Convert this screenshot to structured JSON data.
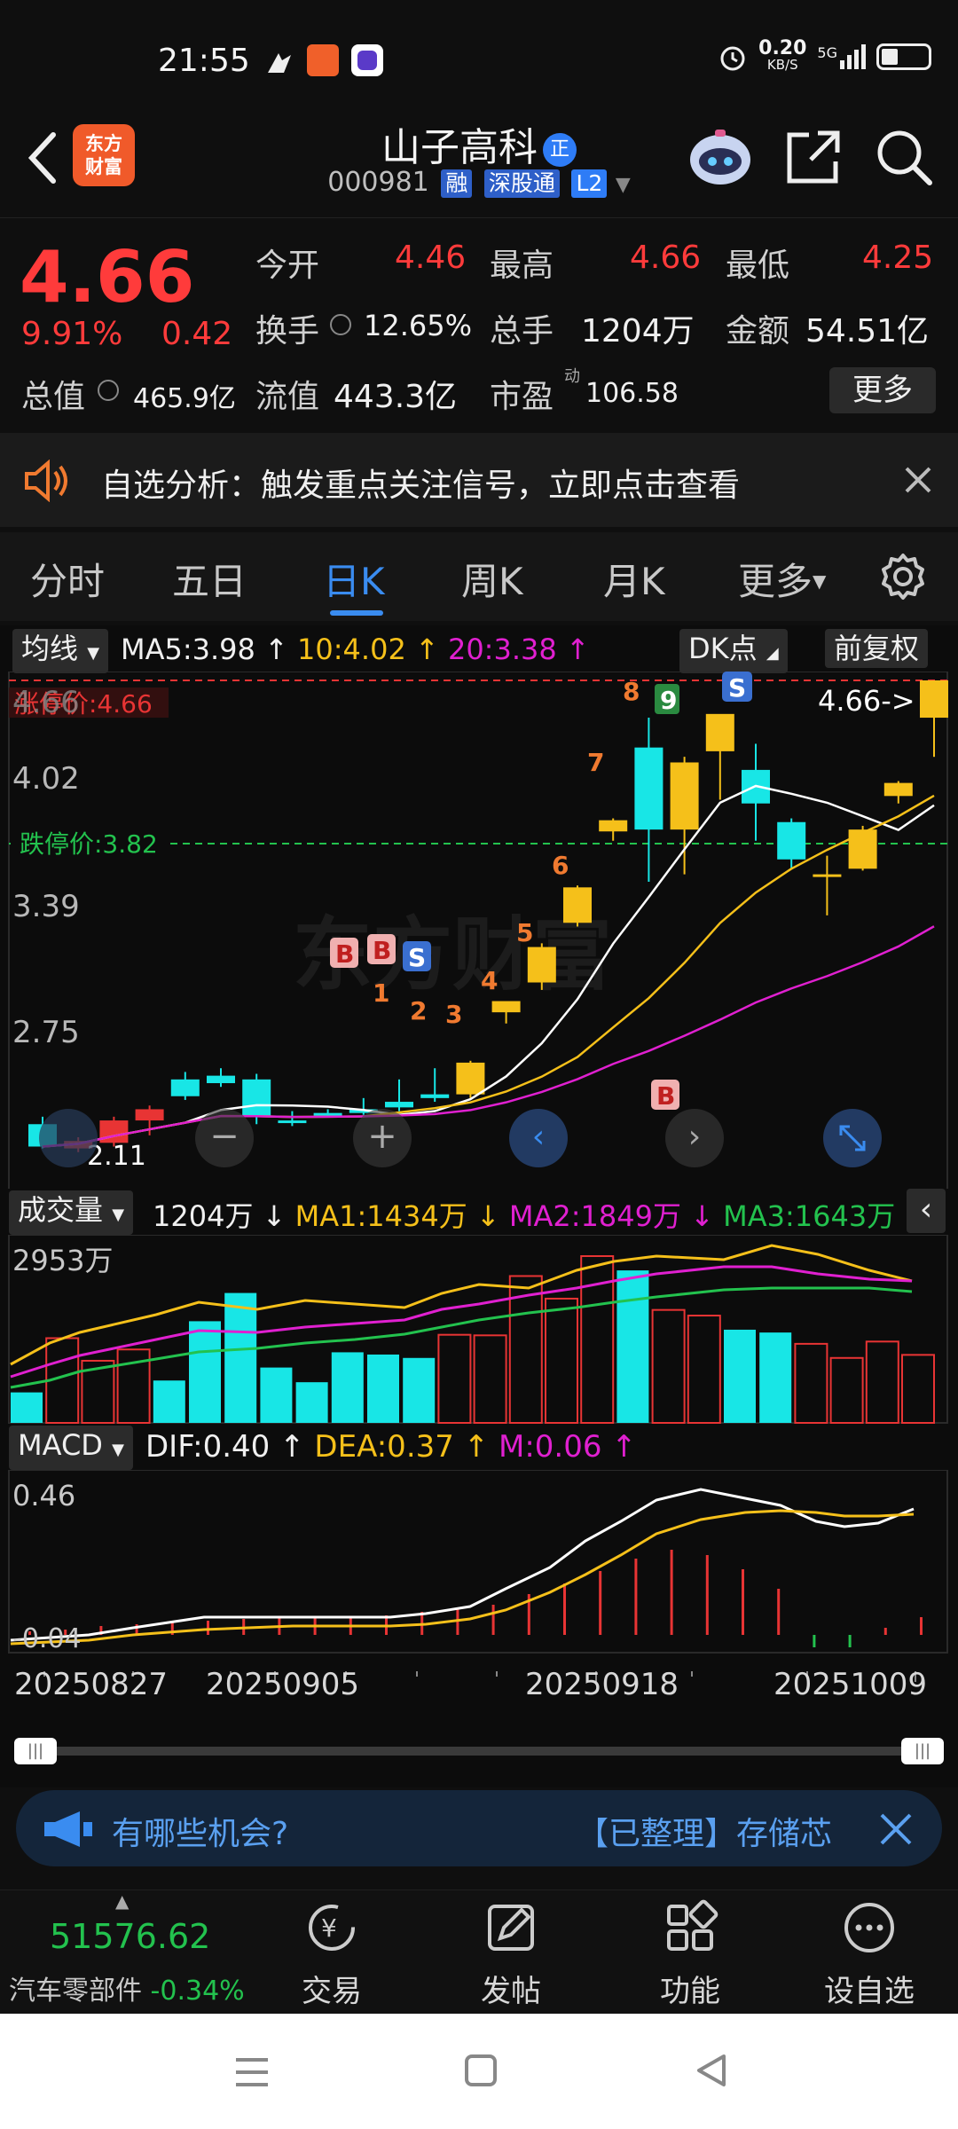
{
  "status": {
    "time": "21:55",
    "speed": "0.20",
    "speed_unit": "KB/S",
    "net": "5G"
  },
  "header": {
    "logo_line1": "东方",
    "logo_line2": "财富",
    "name": "山子高科",
    "name_badge": "正",
    "code": "000981",
    "tag_rong": "融",
    "tag_sgt": "深股通",
    "tag_l2": "L2"
  },
  "quote": {
    "price": "4.66",
    "pct": "9.91%",
    "change": "0.42",
    "open_label": "今开",
    "open": "4.46",
    "high_label": "最高",
    "high": "4.66",
    "low_label": "最低",
    "low": "4.25",
    "turnover_label": "换手",
    "turnover": "12.65%",
    "volume_label": "总手",
    "volume": "1204万",
    "amount_label": "金额",
    "amount": "54.51亿",
    "mktcap_label": "总值",
    "mktcap": "465.9亿",
    "float_label": "流值",
    "float": "443.3亿",
    "pe_label": "市盈",
    "pe_sup": "动",
    "pe": "106.58",
    "more": "更多"
  },
  "notice": {
    "text": "自选分析：触发重点关注信号，立即点击查看"
  },
  "tabs": [
    {
      "label": "分时"
    },
    {
      "label": "五日"
    },
    {
      "label": "日K"
    },
    {
      "label": "周K"
    },
    {
      "label": "月K"
    },
    {
      "label": "更多"
    }
  ],
  "kline": {
    "indicator": "均线",
    "ma5": "MA5:3.98",
    "ma10": "10:4.02",
    "ma20": "20:3.38",
    "dk_label": "DK点",
    "adjust": "前复权",
    "y_top": "4.66",
    "y2": "4.02",
    "y3": "3.39",
    "y4": "2.75",
    "y_bot": "2.11",
    "limit_up_label": "涨停价:4.66",
    "limit_down_label": "跌停价:3.82",
    "last_label": "4.66->",
    "low_label": "2.11",
    "watermark": "东方财富"
  },
  "chart_data": [
    {
      "type": "candlestick",
      "title": "",
      "ylim": [
        2.11,
        4.66
      ],
      "candles": [
        {
          "o": 2.28,
          "h": 2.32,
          "l": 2.15,
          "c": 2.16
        },
        {
          "o": 2.15,
          "h": 2.21,
          "l": 2.13,
          "c": 2.19
        },
        {
          "o": 2.18,
          "h": 2.32,
          "l": 2.16,
          "c": 2.3
        },
        {
          "o": 2.3,
          "h": 2.38,
          "l": 2.22,
          "c": 2.36
        },
        {
          "o": 2.52,
          "h": 2.56,
          "l": 2.41,
          "c": 2.43
        },
        {
          "o": 2.54,
          "h": 2.58,
          "l": 2.48,
          "c": 2.5
        },
        {
          "o": 2.52,
          "h": 2.55,
          "l": 2.28,
          "c": 2.32
        },
        {
          "o": 2.3,
          "h": 2.35,
          "l": 2.27,
          "c": 2.29
        },
        {
          "o": 2.34,
          "h": 2.36,
          "l": 2.32,
          "c": 2.33
        },
        {
          "o": 2.36,
          "h": 2.42,
          "l": 2.33,
          "c": 2.34
        },
        {
          "o": 2.4,
          "h": 2.52,
          "l": 2.35,
          "c": 2.37
        },
        {
          "o": 2.44,
          "h": 2.58,
          "l": 2.4,
          "c": 2.42
        },
        {
          "o": 2.44,
          "h": 2.62,
          "l": 2.42,
          "c": 2.61
        },
        {
          "o": 2.88,
          "h": 2.92,
          "l": 2.82,
          "c": 2.94
        },
        {
          "o": 3.04,
          "h": 3.25,
          "l": 3.0,
          "c": 3.23
        },
        {
          "o": 3.36,
          "h": 3.56,
          "l": 3.34,
          "c": 3.55
        },
        {
          "o": 3.85,
          "h": 3.92,
          "l": 3.8,
          "c": 3.91
        },
        {
          "o": 4.3,
          "h": 4.46,
          "l": 3.58,
          "c": 3.86
        },
        {
          "o": 3.86,
          "h": 4.25,
          "l": 3.62,
          "c": 4.22
        },
        {
          "o": 4.28,
          "h": 4.46,
          "l": 4.02,
          "c": 4.48
        },
        {
          "o": 4.18,
          "h": 4.32,
          "l": 3.8,
          "c": 4.0
        },
        {
          "o": 3.9,
          "h": 3.92,
          "l": 3.65,
          "c": 3.7
        },
        {
          "o": 3.62,
          "h": 3.72,
          "l": 3.4,
          "c": 3.62
        },
        {
          "o": 3.65,
          "h": 3.88,
          "l": 3.64,
          "c": 3.86
        },
        {
          "o": 4.04,
          "h": 4.12,
          "l": 4.0,
          "c": 4.11
        },
        {
          "o": 4.46,
          "h": 4.66,
          "l": 4.25,
          "c": 4.66
        }
      ]
    },
    {
      "type": "bar",
      "title": "成交量",
      "volume_label": "1204万",
      "ma1": "MA1:1434万",
      "ma2": "MA2:1849万",
      "ma3": "MA3:1643万",
      "ymax_label": "2953万",
      "values": [
        540,
        1500,
        1100,
        1300,
        750,
        1800,
        2300,
        980,
        720,
        1250,
        1210,
        1150,
        1560,
        1550,
        2600,
        2200,
        2953,
        2700,
        2000,
        1900,
        1650,
        1600,
        1400,
        1150,
        1440,
        1204
      ]
    },
    {
      "type": "macd",
      "label": "MACD",
      "dif": "DIF:0.40",
      "dea": "DEA:0.37",
      "m": "M:0.06",
      "ymax_label": "0.46",
      "ymin_label": "-0.04",
      "x_labels": [
        "20250827",
        "20250905",
        "20250918",
        "20251009"
      ]
    }
  ],
  "news": {
    "left": "有哪些机会?",
    "right": "【已整理】存储芯"
  },
  "bottom": {
    "index_value": "51576.62",
    "index_name": "汽车零部件",
    "index_chg": "-0.34%",
    "nav": [
      "交易",
      "发帖",
      "功能",
      "设自选"
    ]
  },
  "colors": {
    "up": "#e83434",
    "down": "#18e6e6",
    "accent": "#3a8cf0",
    "yellow": "#f5c01a",
    "magenta": "#e020d0"
  }
}
